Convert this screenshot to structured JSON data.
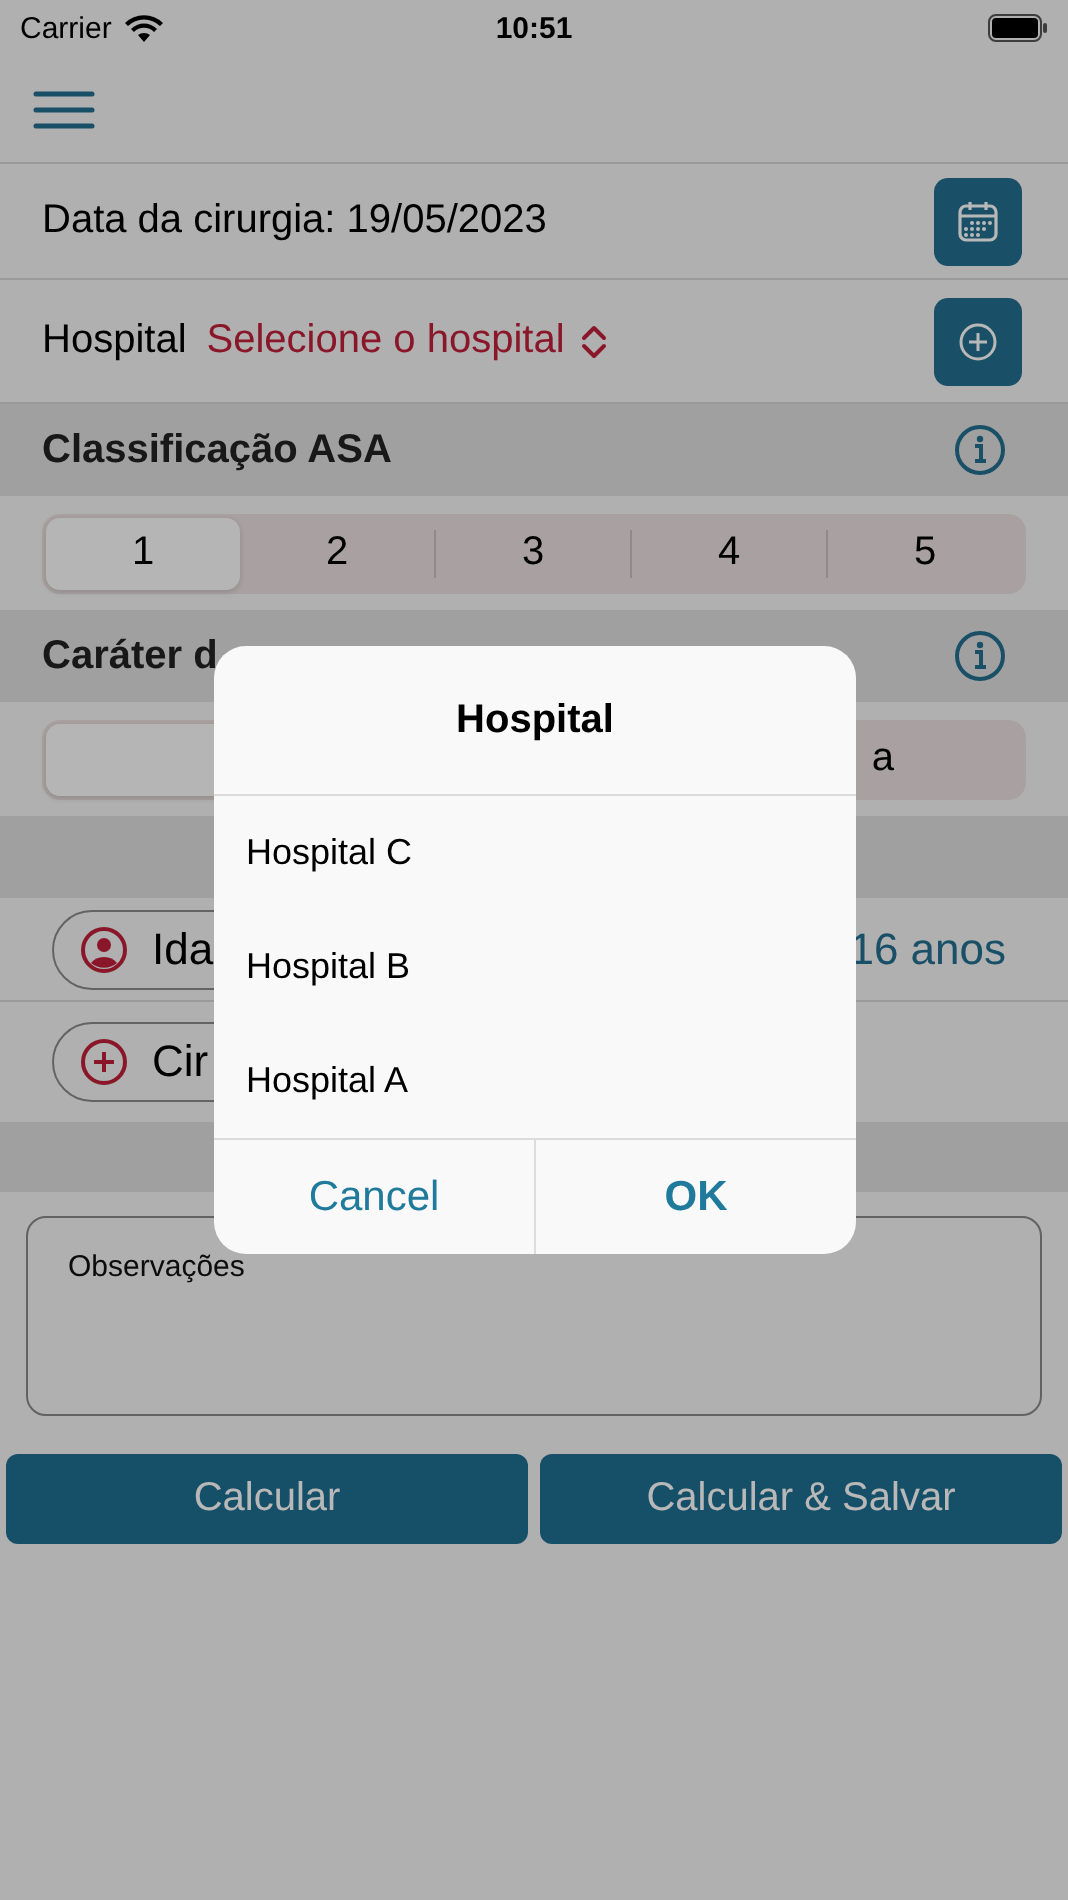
{
  "status_bar": {
    "carrier": "Carrier",
    "time": "10:51"
  },
  "surgery_date": {
    "label": "Data da cirurgia: 19/05/2023"
  },
  "hospital": {
    "label": "Hospital",
    "placeholder": "Selecione o hospital"
  },
  "asa": {
    "title": "Classificação ASA",
    "options": [
      {
        "label": "1",
        "selected": true
      },
      {
        "label": "2",
        "selected": false
      },
      {
        "label": "3",
        "selected": false
      },
      {
        "label": "4",
        "selected": false
      },
      {
        "label": "5",
        "selected": false
      }
    ]
  },
  "character": {
    "title": "Caráter d",
    "options": [
      {
        "selected": true
      },
      {
        "label": "a",
        "selected": false
      }
    ]
  },
  "patient_rows": [
    {
      "kind": "age",
      "label": "Ida",
      "value": "16 anos"
    },
    {
      "kind": "surgery",
      "label": "Cir"
    }
  ],
  "notes": {
    "placeholder": "Observações"
  },
  "buttons": [
    "Calcular",
    "Calcular & Salvar"
  ],
  "dialog": {
    "title": "Hospital",
    "options": [
      "Hospital C",
      "Hospital B",
      "Hospital A"
    ],
    "buttons": [
      {
        "label": "Cancel",
        "kind": "cancel"
      },
      {
        "label": "OK",
        "kind": "confirm"
      }
    ]
  }
}
